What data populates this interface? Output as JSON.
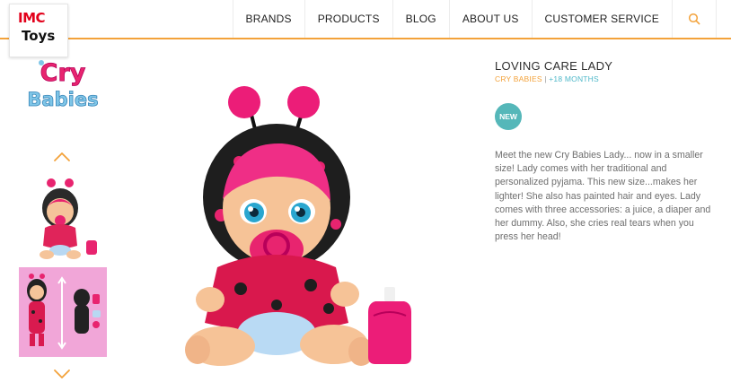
{
  "header": {
    "logo_line1": "IMC",
    "logo_line2": "Toys",
    "nav": [
      "BRANDS",
      "PRODUCTS",
      "BLOG",
      "ABOUT US",
      "CUSTOMER SERVICE"
    ],
    "search_icon": "search-icon"
  },
  "brand_logo": {
    "line1": "Cry",
    "line2": "Babies"
  },
  "gallery": {
    "up_icon": "chevron-up-icon",
    "down_icon": "chevron-down-icon",
    "thumbnails": 2
  },
  "product": {
    "title": "LOVING CARE LADY",
    "brand": "CRY BABIES",
    "separator": "|",
    "age": "+18 MONTHS",
    "badge": "NEW",
    "description": "Meet the new Cry Babies Lady... now in a smaller size! Lady comes with her traditional and personalized pyjama. This new size...makes her lighter! She also has painted hair and eyes. Lady comes with three accessories: a juice, a diaper and her dummy. Also, she cries real tears when you press her head!"
  },
  "colors": {
    "accent_orange": "#f3a23a",
    "teal": "#4fb8c9",
    "badge": "#55b7b9",
    "pink": "#e8246f"
  }
}
